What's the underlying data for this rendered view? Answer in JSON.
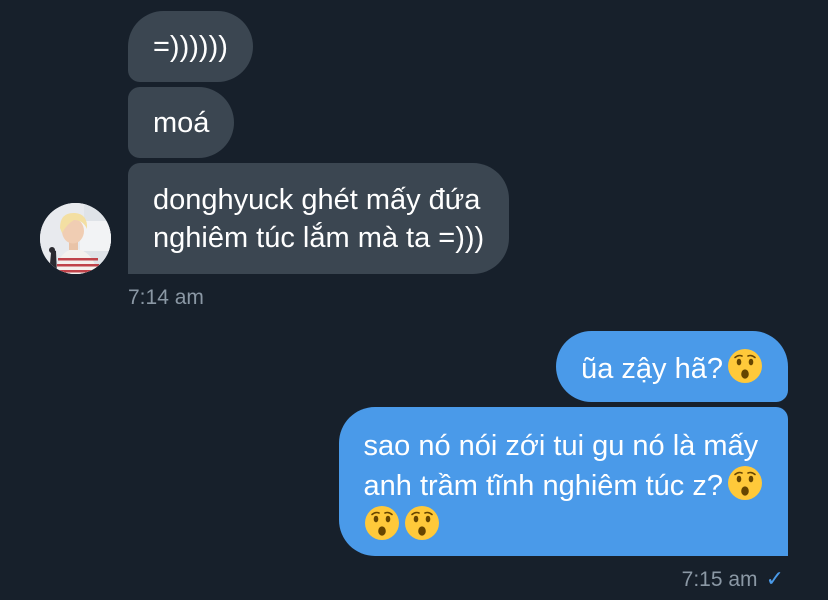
{
  "colors": {
    "background": "#17202b",
    "incoming_bubble": "#3b4651",
    "outgoing_bubble": "#4a9ae9",
    "timestamp": "#8b98a5",
    "read_check": "#4a9ae9"
  },
  "conversation": {
    "incoming": {
      "messages": [
        {
          "text": "=))))))"
        },
        {
          "text": "moá"
        },
        {
          "lines": [
            "donghyuck ghét mấy đứa",
            "nghiêm túc lắm mà ta =)))"
          ]
        }
      ],
      "timestamp": "7:14 am",
      "avatar_icon": "avatar-blonde-boy"
    },
    "outgoing": {
      "messages": [
        {
          "text": "ũa zậy hã?",
          "emoji": "hushed-face"
        },
        {
          "lines": [
            "sao nó nói zới tui gu nó là mấy",
            "anh trầm tĩnh nghiêm túc z?"
          ],
          "emoji": [
            "hushed-face",
            "hushed-face",
            "hushed-face"
          ]
        }
      ],
      "timestamp": "7:15 am",
      "read_icon": "checkmark-icon",
      "read_glyph": "✓"
    }
  }
}
